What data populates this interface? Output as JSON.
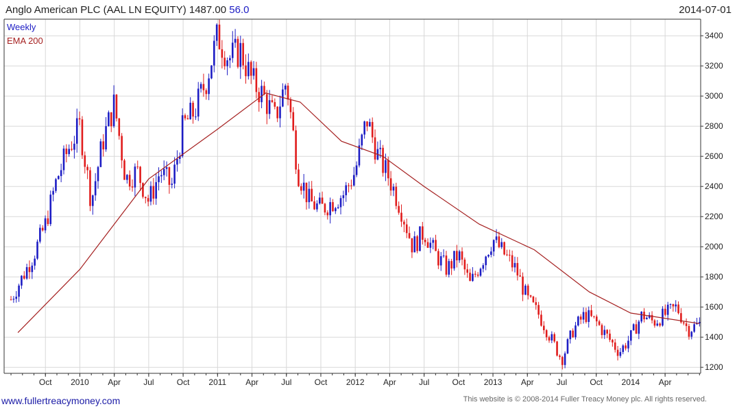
{
  "header": {
    "title": "Anglo American PLC (AAL LN EQUITY) 1487.00",
    "change": "56.0",
    "date": "2014-07-01"
  },
  "legend": {
    "weekly": "Weekly",
    "ema": "EMA 200"
  },
  "footer": {
    "site": "www.fullertreacymoney.com",
    "copyright": "This website is © 2008-2014 Fuller Treacy Money plc. All rights reserved."
  },
  "colors": {
    "up": "#1c1cc4",
    "down": "#e01b1b",
    "ema": "#a52020",
    "grid": "#d8d8d8",
    "axis": "#333333",
    "title_change": "#1c1cc4"
  },
  "chart_data": {
    "type": "line",
    "subtype": "weekly-ohlc",
    "title": "Anglo American PLC (AAL LN EQUITY) 1487.00 56.0",
    "xlabel": "",
    "ylabel": "",
    "ylim": [
      1160,
      3510
    ],
    "y_ticks": [
      1200,
      1400,
      1600,
      1800,
      2000,
      2200,
      2400,
      2600,
      2800,
      3000,
      3200,
      3400
    ],
    "x_tick_labels": [
      "Oct",
      "2010",
      "Apr",
      "Jul",
      "Oct",
      "2011",
      "Apr",
      "Jul",
      "Oct",
      "2012",
      "Apr",
      "Jul",
      "Oct",
      "2013",
      "Apr",
      "Jul",
      "Oct",
      "2014",
      "Apr"
    ],
    "x_range": [
      "2009-07",
      "2014-07"
    ],
    "grid": true,
    "legend_position": "top-left",
    "price_path": [
      [
        "2009-07",
        1650
      ],
      [
        "2009-08",
        1800
      ],
      [
        "2009-09",
        1950
      ],
      [
        "2009-10",
        2150
      ],
      [
        "2009-11",
        2450
      ],
      [
        "2009-12",
        2650
      ],
      [
        "2010-01",
        2800
      ],
      [
        "2010-02",
        2300
      ],
      [
        "2010-03",
        2700
      ],
      [
        "2010-04",
        2950
      ],
      [
        "2010-05",
        2450
      ],
      [
        "2010-06",
        2500
      ],
      [
        "2010-07",
        2300
      ],
      [
        "2010-08",
        2500
      ],
      [
        "2010-09",
        2400
      ],
      [
        "2010-10",
        2800
      ],
      [
        "2010-11",
        2900
      ],
      [
        "2010-12",
        3100
      ],
      [
        "2011-01",
        3400
      ],
      [
        "2011-02",
        3250
      ],
      [
        "2011-03",
        3300
      ],
      [
        "2011-04",
        3100
      ],
      [
        "2011-05",
        3000
      ],
      [
        "2011-06",
        2850
      ],
      [
        "2011-07",
        3100
      ],
      [
        "2011-08",
        2500
      ],
      [
        "2011-09",
        2300
      ],
      [
        "2011-10",
        2250
      ],
      [
        "2011-11",
        2300
      ],
      [
        "2011-12",
        2350
      ],
      [
        "2012-01",
        2500
      ],
      [
        "2012-02",
        2850
      ],
      [
        "2012-03",
        2600
      ],
      [
        "2012-04",
        2450
      ],
      [
        "2012-05",
        2250
      ],
      [
        "2012-06",
        2000
      ],
      [
        "2012-07",
        2100
      ],
      [
        "2012-08",
        1950
      ],
      [
        "2012-09",
        1850
      ],
      [
        "2012-10",
        1950
      ],
      [
        "2012-11",
        1750
      ],
      [
        "2012-12",
        1900
      ],
      [
        "2013-01",
        2050
      ],
      [
        "2013-02",
        1950
      ],
      [
        "2013-03",
        1850
      ],
      [
        "2013-04",
        1650
      ],
      [
        "2013-05",
        1550
      ],
      [
        "2013-06",
        1400
      ],
      [
        "2013-07",
        1250
      ],
      [
        "2013-08",
        1450
      ],
      [
        "2013-09",
        1550
      ],
      [
        "2013-10",
        1500
      ],
      [
        "2013-11",
        1400
      ],
      [
        "2013-12",
        1300
      ],
      [
        "2014-01",
        1400
      ],
      [
        "2014-02",
        1550
      ],
      [
        "2014-03",
        1500
      ],
      [
        "2014-04",
        1550
      ],
      [
        "2014-05",
        1600
      ],
      [
        "2014-06",
        1450
      ],
      [
        "2014-07",
        1487
      ]
    ],
    "series": [
      {
        "name": "EMA 200",
        "values": [
          [
            2009.55,
            1430
          ],
          [
            2010.0,
            1850
          ],
          [
            2010.5,
            2450
          ],
          [
            2011.0,
            2780
          ],
          [
            2011.35,
            3020
          ],
          [
            2011.6,
            2960
          ],
          [
            2011.9,
            2700
          ],
          [
            2012.2,
            2600
          ],
          [
            2012.5,
            2400
          ],
          [
            2012.9,
            2150
          ],
          [
            2013.3,
            1980
          ],
          [
            2013.7,
            1700
          ],
          [
            2014.0,
            1560
          ],
          [
            2014.5,
            1490
          ]
        ]
      }
    ]
  }
}
